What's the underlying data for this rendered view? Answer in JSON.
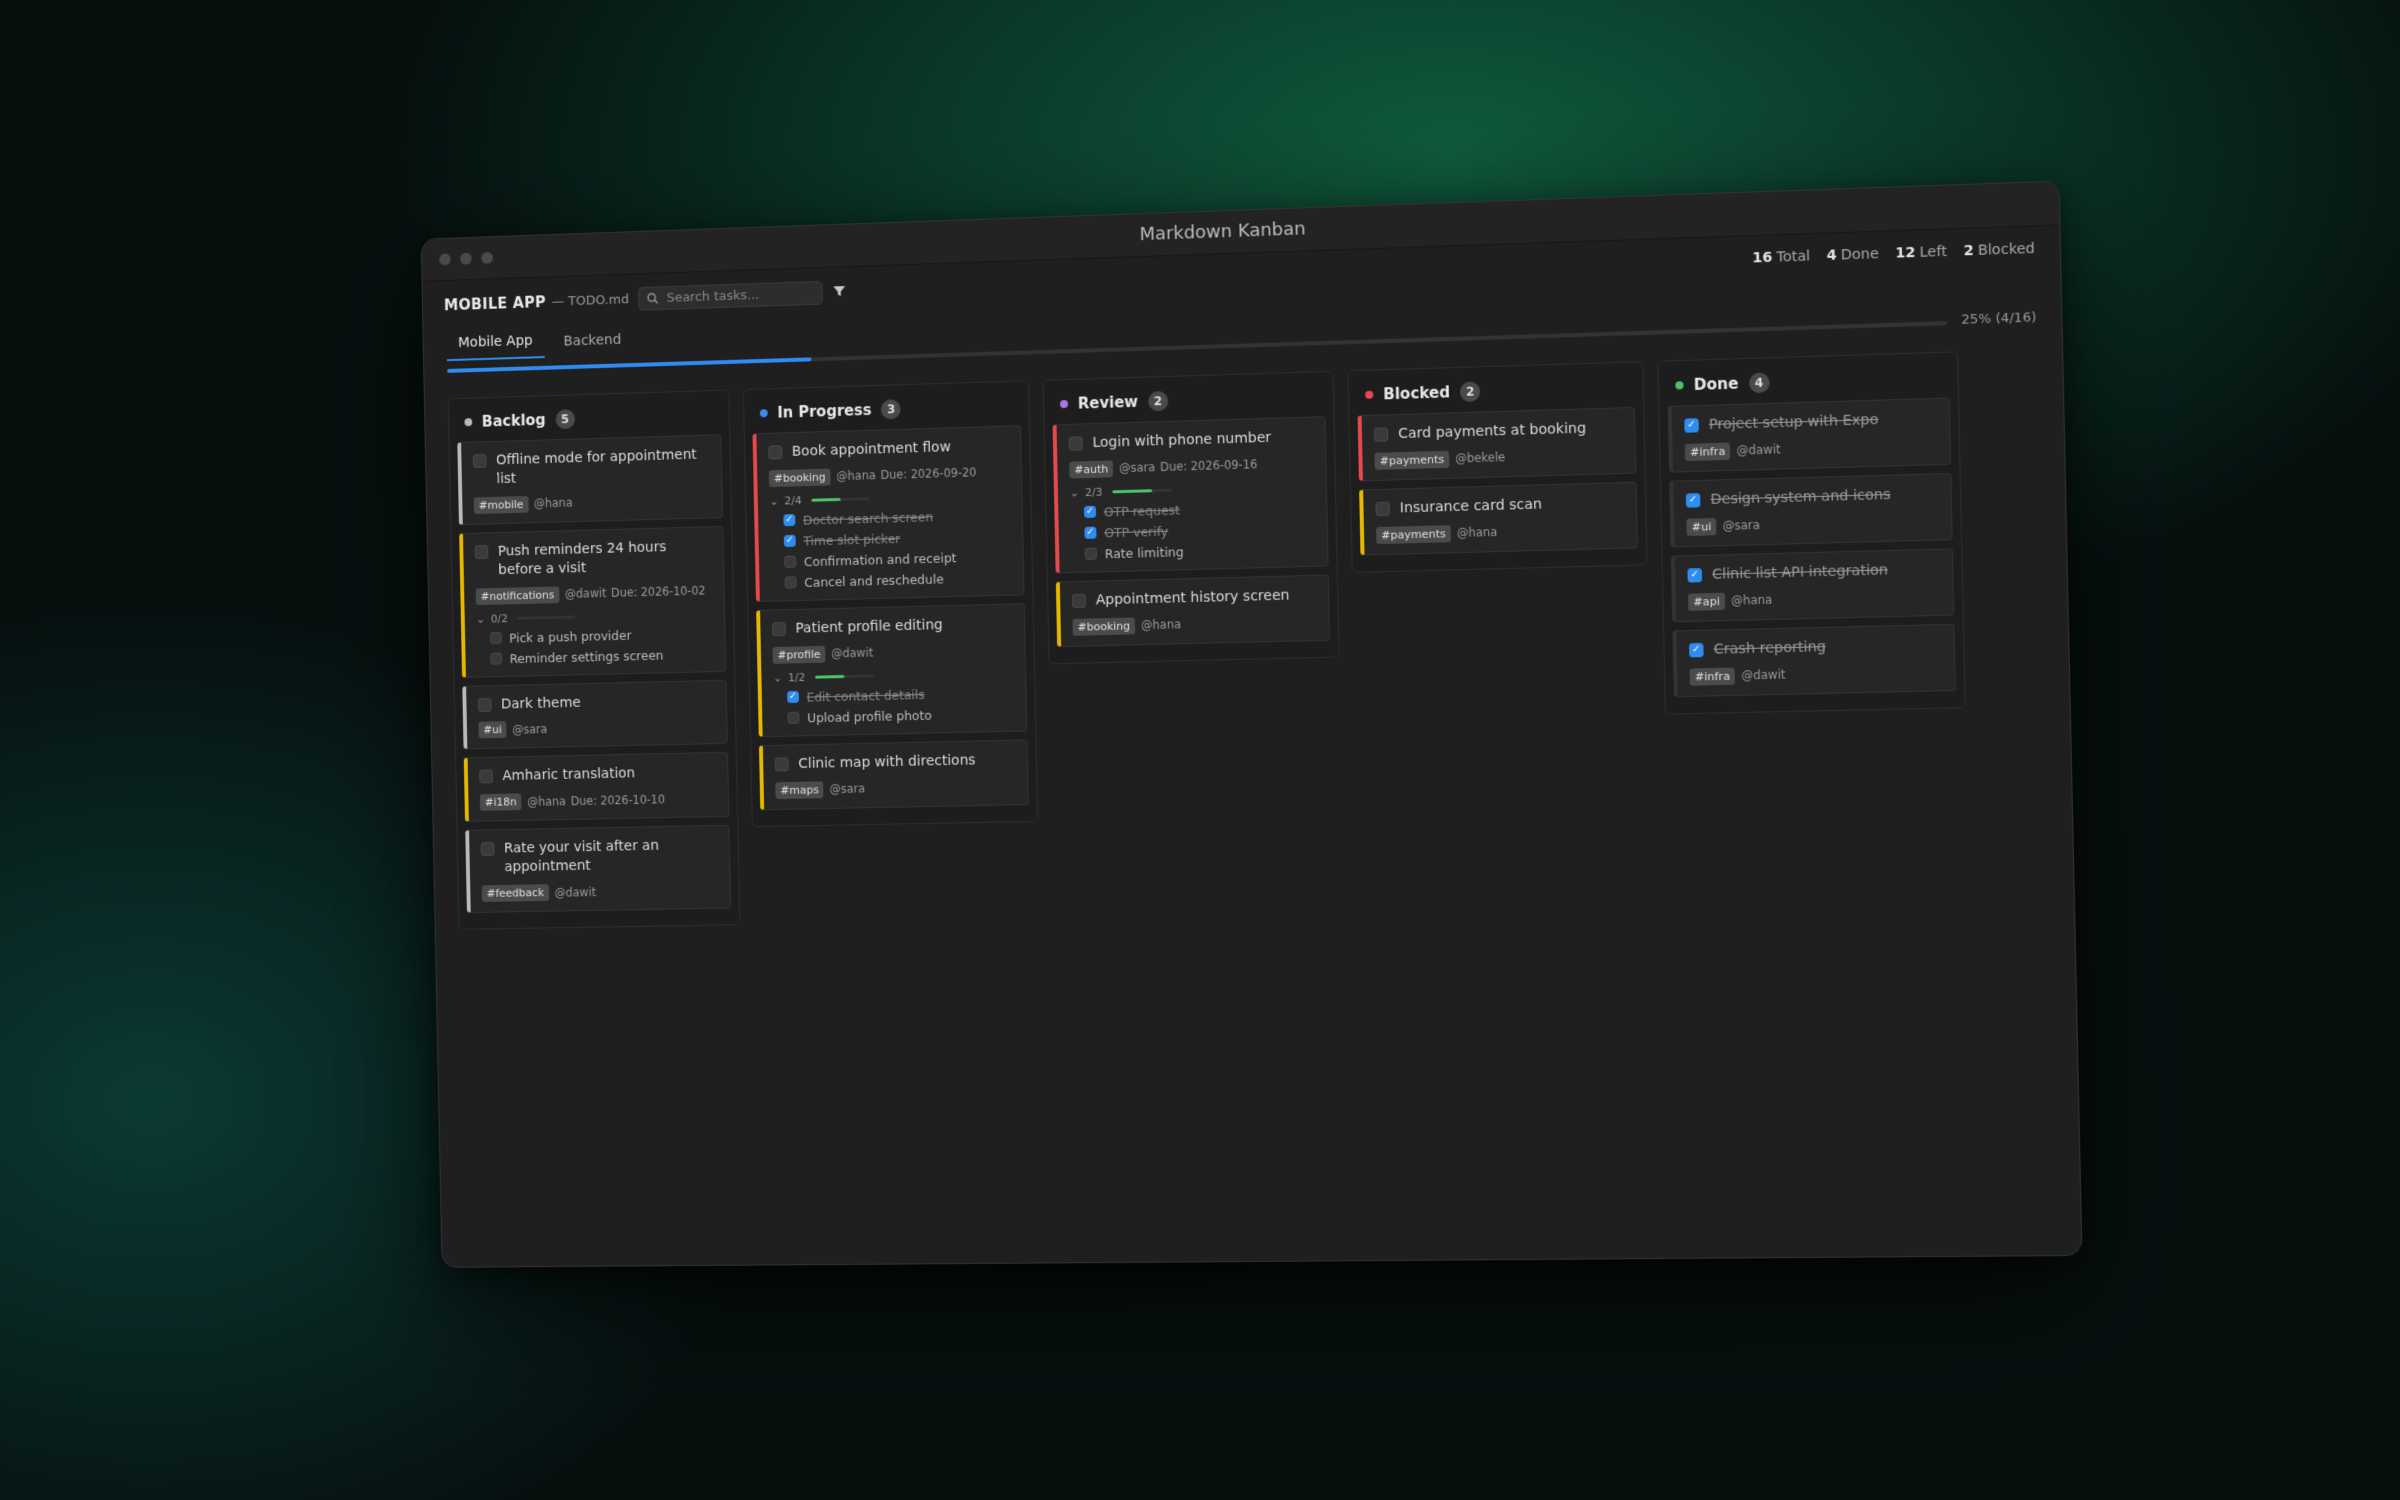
{
  "window": {
    "title": "Markdown Kanban"
  },
  "toolbar": {
    "board_name": "MOBILE APP",
    "file_label": "— TODO.md",
    "search_placeholder": "Search tasks..."
  },
  "stats": {
    "total_value": "16",
    "total_label": "Total",
    "done_value": "4",
    "done_label": "Done",
    "left_value": "12",
    "left_label": "Left",
    "blocked_value": "2",
    "blocked_label": "Blocked"
  },
  "tabs": [
    {
      "label": "Mobile App",
      "active": true
    },
    {
      "label": "Backend",
      "active": false
    }
  ],
  "progress": {
    "fraction": 0.25,
    "label": "25% (4/16)"
  },
  "colors": {
    "accent": "#2f8cf0",
    "backlog": "#b9b9b9",
    "in_progress": "#3d8bf2",
    "review": "#a977e8",
    "blocked": "#e5484d",
    "done": "#4cc36a",
    "priority_high": "#e5484d",
    "priority_medium": "#e6b800",
    "priority_low": "#b9b9b9"
  },
  "columns": [
    {
      "name": "Backlog",
      "count": "5",
      "dot_color": "#b9b9b9",
      "cards": [
        {
          "title": "Offline mode for appointment list",
          "tag": "#mobile",
          "owner": "@hana",
          "due": "",
          "priority_color": "#b9b9b9",
          "done": false,
          "subtasks": null
        },
        {
          "title": "Push reminders 24 hours before a visit",
          "tag": "#notifications",
          "owner": "@dawit",
          "due": "Due: 2026-10-02",
          "priority_color": "#e6b800",
          "done": false,
          "subtasks": {
            "progress": "0/2",
            "fraction": 0,
            "items": [
              {
                "text": "Pick a push provider",
                "done": false
              },
              {
                "text": "Reminder settings screen",
                "done": false
              }
            ]
          }
        },
        {
          "title": "Dark theme",
          "tag": "#ui",
          "owner": "@sara",
          "due": "",
          "priority_color": "#b9b9b9",
          "done": false,
          "subtasks": null
        },
        {
          "title": "Amharic translation",
          "tag": "#i18n",
          "owner": "@hana",
          "due": "Due: 2026-10-10",
          "priority_color": "#e6b800",
          "done": false,
          "subtasks": null
        },
        {
          "title": "Rate your visit after an appointment",
          "tag": "#feedback",
          "owner": "@dawit",
          "due": "",
          "priority_color": "#b9b9b9",
          "done": false,
          "subtasks": null
        }
      ]
    },
    {
      "name": "In Progress",
      "count": "3",
      "dot_color": "#3d8bf2",
      "cards": [
        {
          "title": "Book appointment flow",
          "tag": "#booking",
          "owner": "@hana",
          "due": "Due: 2026-09-20",
          "priority_color": "#e5484d",
          "done": false,
          "subtasks": {
            "progress": "2/4",
            "fraction": 0.5,
            "items": [
              {
                "text": "Doctor search screen",
                "done": true
              },
              {
                "text": "Time slot picker",
                "done": true
              },
              {
                "text": "Confirmation and receipt",
                "done": false
              },
              {
                "text": "Cancel and reschedule",
                "done": false
              }
            ]
          }
        },
        {
          "title": "Patient profile editing",
          "tag": "#profile",
          "owner": "@dawit",
          "due": "",
          "priority_color": "#e6b800",
          "done": false,
          "subtasks": {
            "progress": "1/2",
            "fraction": 0.5,
            "items": [
              {
                "text": "Edit contact details",
                "done": true
              },
              {
                "text": "Upload profile photo",
                "done": false
              }
            ]
          }
        },
        {
          "title": "Clinic map with directions",
          "tag": "#maps",
          "owner": "@sara",
          "due": "",
          "priority_color": "#e6b800",
          "done": false,
          "subtasks": null
        }
      ]
    },
    {
      "name": "Review",
      "count": "2",
      "dot_color": "#a977e8",
      "cards": [
        {
          "title": "Login with phone number",
          "tag": "#auth",
          "owner": "@sara",
          "due": "Due: 2026-09-16",
          "priority_color": "#e5484d",
          "done": false,
          "subtasks": {
            "progress": "2/3",
            "fraction": 0.667,
            "items": [
              {
                "text": "OTP request",
                "done": true
              },
              {
                "text": "OTP verify",
                "done": true
              },
              {
                "text": "Rate limiting",
                "done": false
              }
            ]
          }
        },
        {
          "title": "Appointment history screen",
          "tag": "#booking",
          "owner": "@hana",
          "due": "",
          "priority_color": "#e6b800",
          "done": false,
          "subtasks": null
        }
      ]
    },
    {
      "name": "Blocked",
      "count": "2",
      "dot_color": "#e5484d",
      "cards": [
        {
          "title": "Card payments at booking",
          "tag": "#payments",
          "owner": "@bekele",
          "due": "",
          "priority_color": "#e5484d",
          "done": false,
          "subtasks": null
        },
        {
          "title": "Insurance card scan",
          "tag": "#payments",
          "owner": "@hana",
          "due": "",
          "priority_color": "#e6b800",
          "done": false,
          "subtasks": null
        }
      ]
    },
    {
      "name": "Done",
      "count": "4",
      "dot_color": "#4cc36a",
      "cards": [
        {
          "title": "Project setup with Expo",
          "tag": "#infra",
          "owner": "@dawit",
          "due": "",
          "priority_color": "",
          "done": true,
          "subtasks": null
        },
        {
          "title": "Design system and icons",
          "tag": "#ui",
          "owner": "@sara",
          "due": "",
          "priority_color": "",
          "done": true,
          "subtasks": null
        },
        {
          "title": "Clinic list API integration",
          "tag": "#api",
          "owner": "@hana",
          "due": "",
          "priority_color": "",
          "done": true,
          "subtasks": null
        },
        {
          "title": "Crash reporting",
          "tag": "#infra",
          "owner": "@dawit",
          "due": "",
          "priority_color": "",
          "done": true,
          "subtasks": null
        }
      ]
    }
  ]
}
